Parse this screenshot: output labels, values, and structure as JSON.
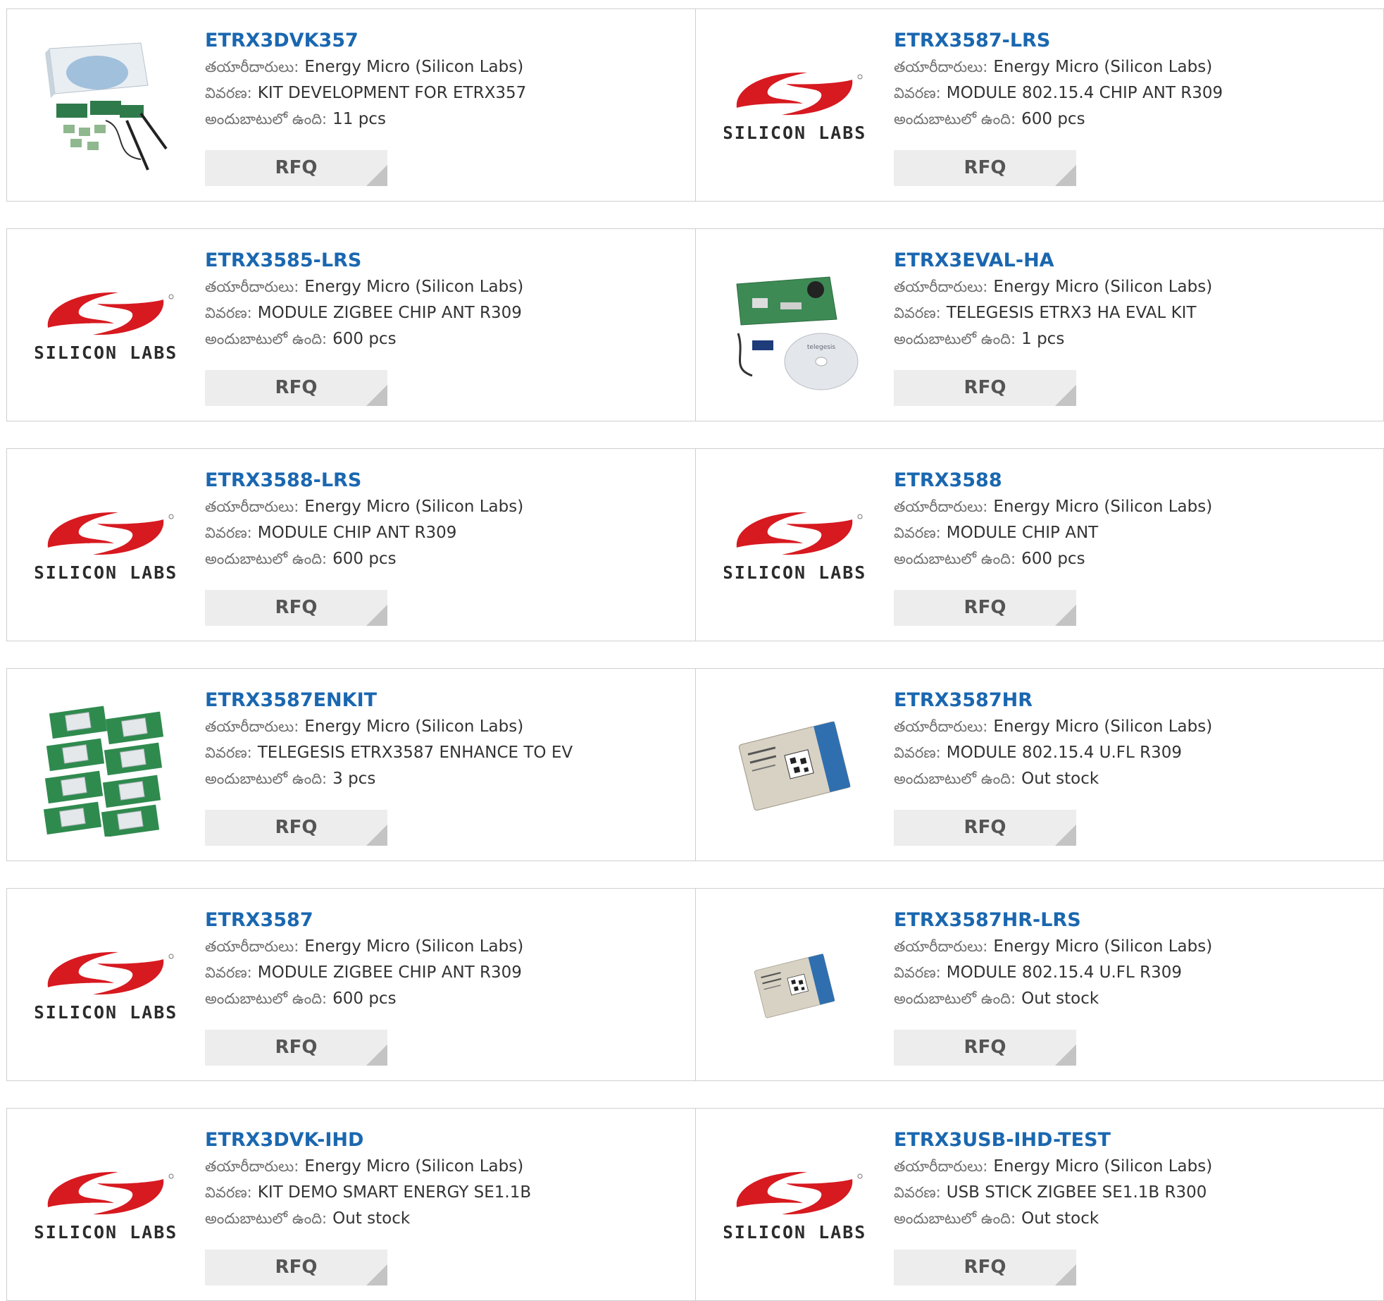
{
  "labels": {
    "manufacturer": "తయారీదారులు:",
    "description": "వివరణ:",
    "stock": "అందుబాటులో ఉంది:",
    "rfq": "RFQ"
  },
  "logo_text": "SILICON LABS",
  "colors": {
    "title_blue": "#1a67b0",
    "logo_red": "#d71920",
    "logo_text": "#2b2b2b",
    "rfq_bg": "#ededed",
    "rfq_corner": "#c4c4c4",
    "border": "#cfcfcf"
  },
  "products": [
    {
      "part": "ETRX3DVK357",
      "manufacturer": "Energy Micro (Silicon Labs)",
      "description": "KIT DEVELOPMENT FOR ETRX357",
      "stock": "11 pcs",
      "image": "dev-kit-box-image"
    },
    {
      "part": "ETRX3587-LRS",
      "manufacturer": "Energy Micro (Silicon Labs)",
      "description": "MODULE 802.15.4 CHIP ANT R309",
      "stock": "600 pcs",
      "image": "silicon-labs-logo"
    },
    {
      "part": "ETRX3585-LRS",
      "manufacturer": "Energy Micro (Silicon Labs)",
      "description": "MODULE ZIGBEE CHIP ANT R309",
      "stock": "600 pcs",
      "image": "silicon-labs-logo"
    },
    {
      "part": "ETRX3EVAL-HA",
      "manufacturer": "Energy Micro (Silicon Labs)",
      "description": "TELEGESIS ETRX3 HA EVAL KIT",
      "stock": "1 pcs",
      "image": "eval-kit-board-cd-image"
    },
    {
      "part": "ETRX3588-LRS",
      "manufacturer": "Energy Micro (Silicon Labs)",
      "description": "MODULE CHIP ANT R309",
      "stock": "600 pcs",
      "image": "silicon-labs-logo"
    },
    {
      "part": "ETRX3588",
      "manufacturer": "Energy Micro (Silicon Labs)",
      "description": "MODULE CHIP ANT",
      "stock": "600 pcs",
      "image": "silicon-labs-logo"
    },
    {
      "part": "ETRX3587ENKIT",
      "manufacturer": "Energy Micro (Silicon Labs)",
      "description": "TELEGESIS ETRX3587 ENHANCE TO EV",
      "stock": "3 pcs",
      "image": "module-boards-image"
    },
    {
      "part": "ETRX3587HR",
      "manufacturer": "Energy Micro (Silicon Labs)",
      "description": "MODULE 802.15.4 U.FL R309",
      "stock": "Out stock",
      "image": "rf-module-image"
    },
    {
      "part": "ETRX3587",
      "manufacturer": "Energy Micro (Silicon Labs)",
      "description": "MODULE ZIGBEE CHIP ANT R309",
      "stock": "600 pcs",
      "image": "silicon-labs-logo"
    },
    {
      "part": "ETRX3587HR-LRS",
      "manufacturer": "Energy Micro (Silicon Labs)",
      "description": "MODULE 802.15.4 U.FL R309",
      "stock": "Out stock",
      "image": "rf-module-small-image"
    },
    {
      "part": "ETRX3DVK-IHD",
      "manufacturer": "Energy Micro (Silicon Labs)",
      "description": "KIT DEMO SMART ENERGY SE1.1B",
      "stock": "Out stock",
      "image": "silicon-labs-logo"
    },
    {
      "part": "ETRX3USB-IHD-TEST",
      "manufacturer": "Energy Micro (Silicon Labs)",
      "description": "USB STICK ZIGBEE SE1.1B R300",
      "stock": "Out stock",
      "image": "silicon-labs-logo"
    }
  ]
}
